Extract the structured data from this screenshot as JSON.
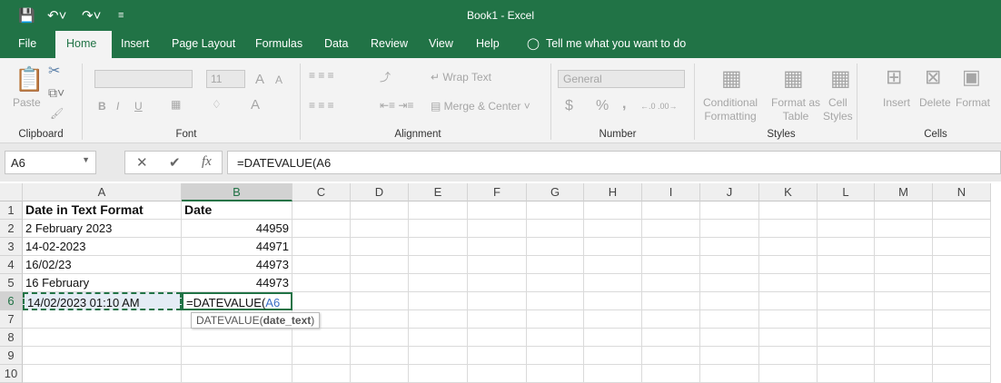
{
  "title": "Book1  -  Excel",
  "quick_access": {
    "save": "save-icon",
    "undo": "undo-icon",
    "redo": "redo-icon"
  },
  "tabs": [
    "File",
    "Home",
    "Insert",
    "Page Layout",
    "Formulas",
    "Data",
    "Review",
    "View",
    "Help"
  ],
  "tell_me": "Tell me what you want to do",
  "ribbon": {
    "clipboard": {
      "paste": "Paste",
      "label": "Clipboard"
    },
    "font": {
      "size": "11",
      "label": "Font",
      "bold": "B",
      "italic": "I",
      "underline": "U",
      "grow": "A",
      "shrink": "A",
      "color": "A"
    },
    "alignment": {
      "wrap": "Wrap Text",
      "merge": "Merge & Center",
      "label": "Alignment"
    },
    "number": {
      "format": "General",
      "currency": "$",
      "percent": "%",
      "comma": ",",
      "label": "Number"
    },
    "styles": {
      "conditional": [
        "Conditional",
        "Formatting"
      ],
      "table": [
        "Format as",
        "Table"
      ],
      "cell": [
        "Cell",
        "Styles"
      ],
      "label": "Styles"
    },
    "cells": {
      "insert": "Insert",
      "delete": "Delete",
      "format": "Format",
      "label": "Cells"
    }
  },
  "name_box": "A6",
  "formula": "=DATEVALUE(A6",
  "columns": [
    "A",
    "B",
    "C",
    "D",
    "E",
    "F",
    "G",
    "H",
    "I",
    "J",
    "K",
    "L",
    "M",
    "N"
  ],
  "rows": [
    "1",
    "2",
    "3",
    "4",
    "5",
    "6",
    "7",
    "8",
    "9",
    "10"
  ],
  "cells": [
    [
      "Date in Text Format",
      "Date"
    ],
    [
      "2 February 2023",
      "44959"
    ],
    [
      "14-02-2023",
      "44971"
    ],
    [
      "16/02/23",
      "44973"
    ],
    [
      "16 February",
      "44973"
    ],
    [
      "14/02/2023 01:10 AM",
      "=DATEVALUE(",
      "A6"
    ]
  ],
  "tooltip": {
    "fn": "DATEVALUE(",
    "arg": "date_text",
    "close": ")"
  }
}
